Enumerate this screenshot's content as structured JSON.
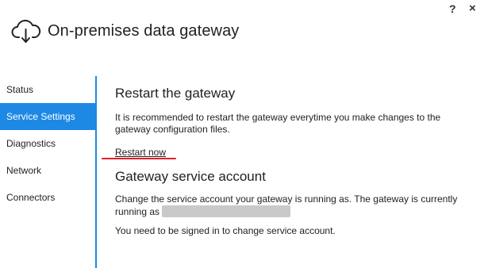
{
  "window": {
    "help_label": "?",
    "close_label": "×"
  },
  "header": {
    "title": "On-premises data gateway",
    "icon": "cloud-upload-icon"
  },
  "sidebar": {
    "items": [
      {
        "label": "Status"
      },
      {
        "label": "Service Settings",
        "active": true
      },
      {
        "label": "Diagnostics"
      },
      {
        "label": "Network"
      },
      {
        "label": "Connectors"
      }
    ]
  },
  "restart": {
    "heading": "Restart the gateway",
    "description": "It is recommended to restart the gateway everytime you make changes to the gateway configuration files.",
    "link": "Restart now"
  },
  "account": {
    "heading": "Gateway service account",
    "description": "Change the service account your gateway is running as. The gateway is currently running as",
    "note": "You need to be signed in to change service account."
  },
  "colors": {
    "accent": "#1e88e5",
    "annotation": "#e0202a",
    "redaction": "#c9c9c9"
  }
}
